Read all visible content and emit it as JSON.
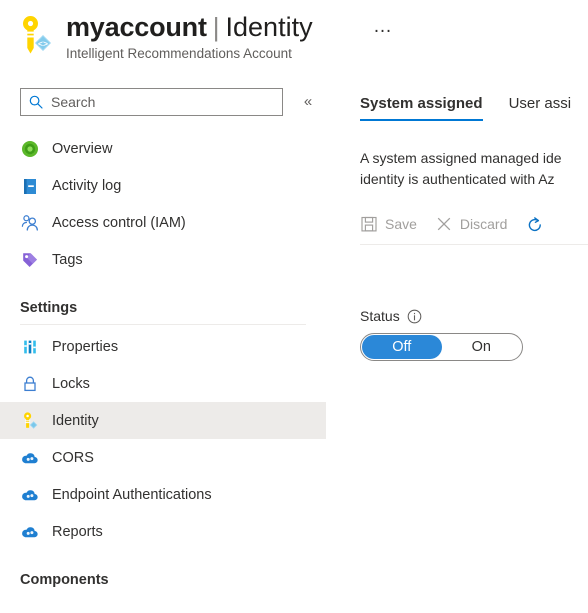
{
  "header": {
    "resource_icon": "key-identity-icon",
    "resource_name": "myaccount",
    "separator": "|",
    "blade_name": "Identity",
    "subtitle": "Intelligent Recommendations Account",
    "more_menu": "…"
  },
  "sidebar": {
    "search": {
      "icon": "search-icon",
      "placeholder": "Search",
      "value": ""
    },
    "collapse_icon": "«",
    "items": [
      {
        "label": "Overview",
        "icon": "overview-icon",
        "selected": false
      },
      {
        "label": "Activity log",
        "icon": "activity-log-icon",
        "selected": false
      },
      {
        "label": "Access control (IAM)",
        "icon": "access-control-icon",
        "selected": false
      },
      {
        "label": "Tags",
        "icon": "tags-icon",
        "selected": false
      }
    ],
    "sections": [
      {
        "title": "Settings",
        "items": [
          {
            "label": "Properties",
            "icon": "properties-icon",
            "selected": false
          },
          {
            "label": "Locks",
            "icon": "locks-icon",
            "selected": false
          },
          {
            "label": "Identity",
            "icon": "identity-key-icon",
            "selected": true
          },
          {
            "label": "CORS",
            "icon": "cors-cloud-icon",
            "selected": false
          },
          {
            "label": "Endpoint Authentications",
            "icon": "endpoint-auth-cloud-icon",
            "selected": false
          },
          {
            "label": "Reports",
            "icon": "reports-cloud-icon",
            "selected": false
          }
        ]
      },
      {
        "title": "Components",
        "items": []
      }
    ]
  },
  "content": {
    "tabs": [
      {
        "label": "System assigned",
        "active": true
      },
      {
        "label": "User assi",
        "active": false
      }
    ],
    "description_lines": [
      "A system assigned managed ide",
      "identity is authenticated with Az"
    ],
    "toolbar": {
      "save_label": "Save",
      "save_icon": "save-icon",
      "discard_label": "Discard",
      "discard_icon": "discard-icon",
      "refresh_icon": "refresh-icon"
    },
    "status": {
      "label": "Status",
      "info_icon": "info-icon",
      "options": [
        {
          "label": "Off",
          "selected": true
        },
        {
          "label": "On",
          "selected": false
        }
      ]
    }
  },
  "colors": {
    "accent_blue": "#0078d4",
    "toggle_blue": "#2b88d8",
    "selected_row": "#edebe9",
    "text_primary": "#323130",
    "text_secondary": "#605e5c",
    "disabled_text": "#a19f9d",
    "key_yellow": "#ffd400",
    "tag_purple": "#7b61d9",
    "overview_green": "#4caf2e"
  }
}
